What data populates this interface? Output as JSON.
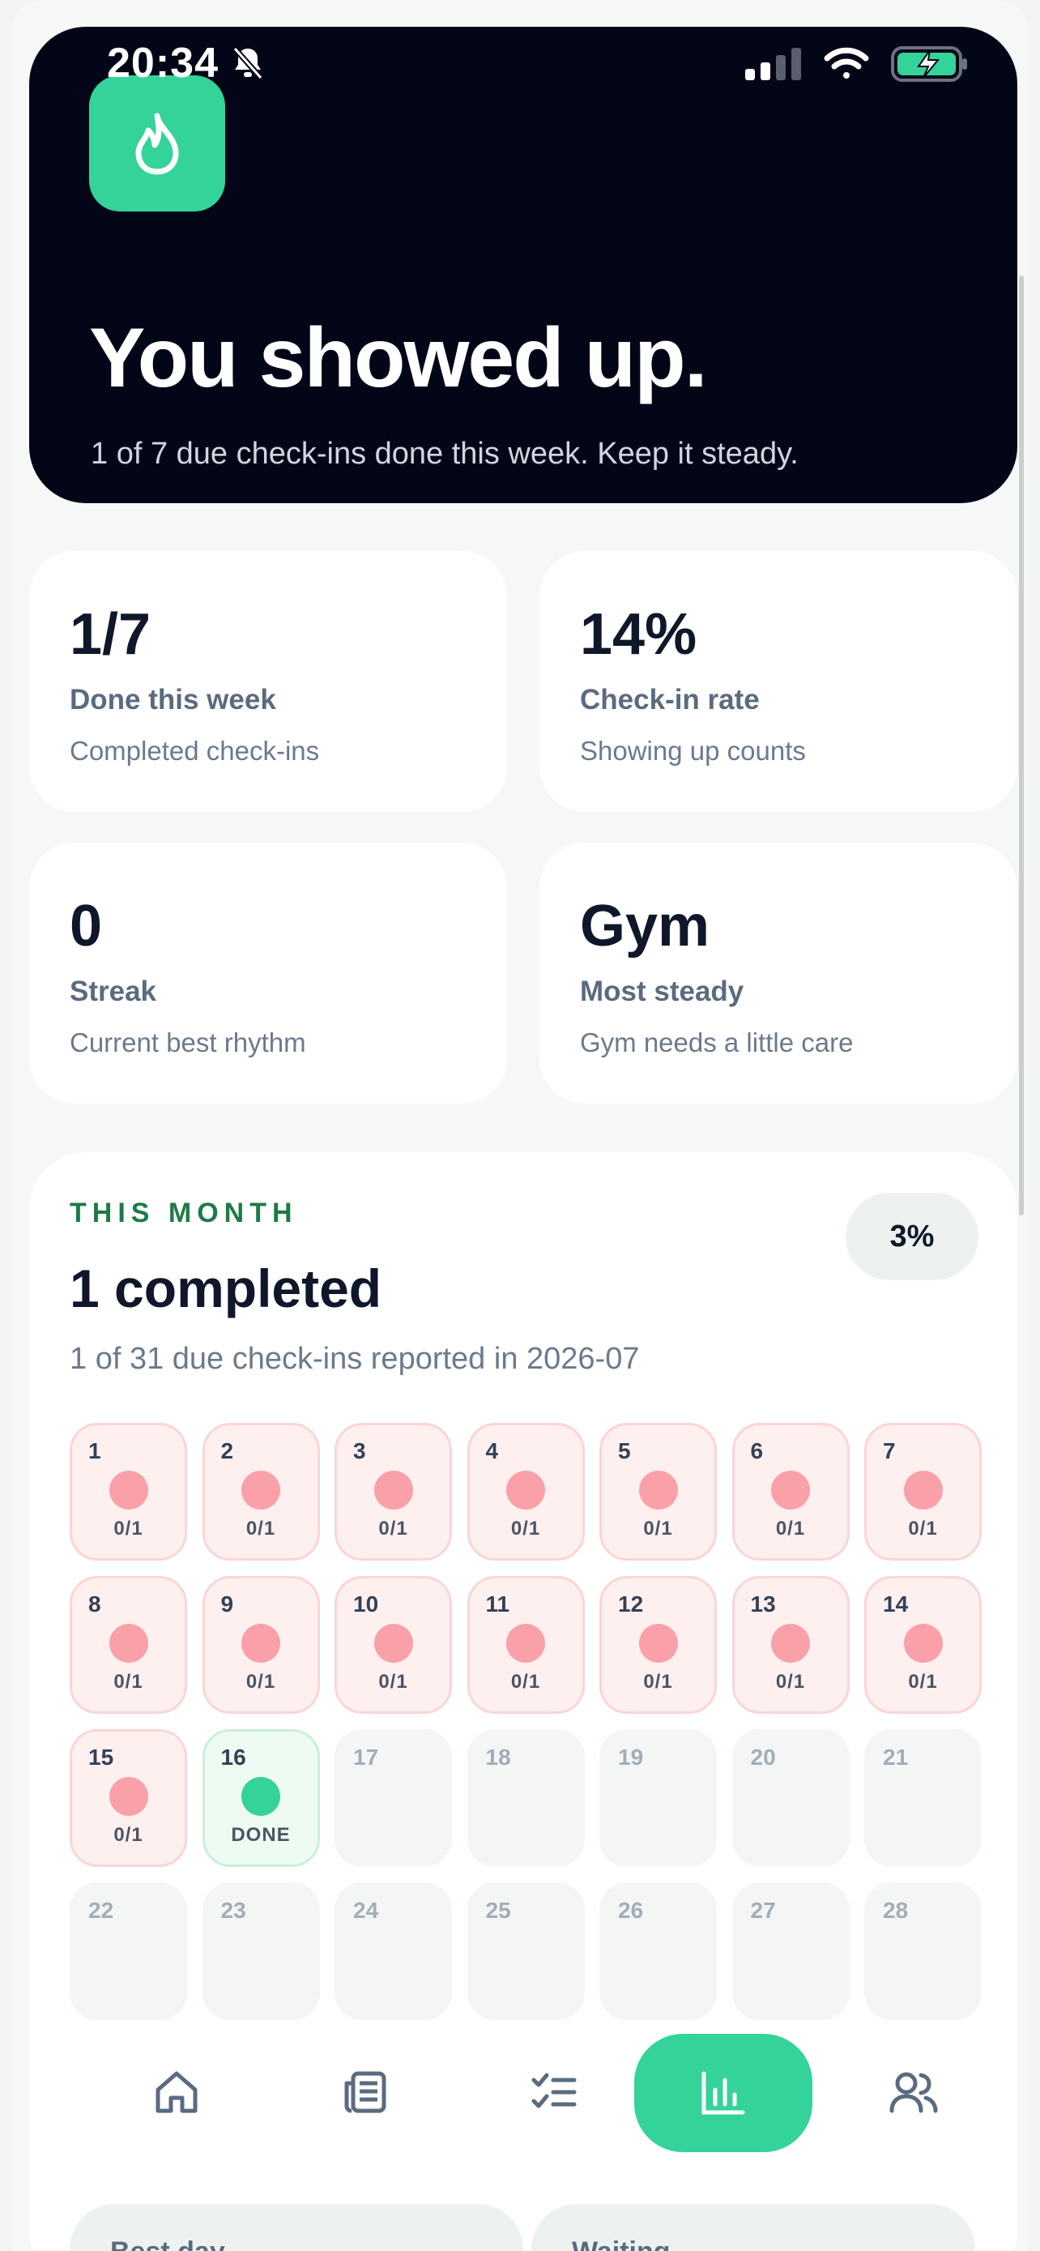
{
  "status": {
    "time": "20:34"
  },
  "hero": {
    "title": "You showed up.",
    "subtitle": "1 of 7 due check-ins done this week. Keep it steady."
  },
  "stats": [
    {
      "value": "1/7",
      "label": "Done this week",
      "desc": "Completed check-ins"
    },
    {
      "value": "14%",
      "label": "Check-in rate",
      "desc": "Showing up counts"
    },
    {
      "value": "0",
      "label": "Streak",
      "desc": "Current best rhythm"
    },
    {
      "value": "Gym",
      "label": "Most steady",
      "desc": "Gym needs a little care"
    }
  ],
  "month": {
    "eyebrow": "THIS MONTH",
    "percent": "3%",
    "headline": "1 completed",
    "subtitle": "1 of 31 due check-ins reported in 2026-07",
    "days": [
      {
        "day": "1",
        "state": "missed",
        "tag": "0/1"
      },
      {
        "day": "2",
        "state": "missed",
        "tag": "0/1"
      },
      {
        "day": "3",
        "state": "missed",
        "tag": "0/1"
      },
      {
        "day": "4",
        "state": "missed",
        "tag": "0/1"
      },
      {
        "day": "5",
        "state": "missed",
        "tag": "0/1"
      },
      {
        "day": "6",
        "state": "missed",
        "tag": "0/1"
      },
      {
        "day": "7",
        "state": "missed",
        "tag": "0/1"
      },
      {
        "day": "8",
        "state": "missed",
        "tag": "0/1"
      },
      {
        "day": "9",
        "state": "missed",
        "tag": "0/1"
      },
      {
        "day": "10",
        "state": "missed",
        "tag": "0/1"
      },
      {
        "day": "11",
        "state": "missed",
        "tag": "0/1"
      },
      {
        "day": "12",
        "state": "missed",
        "tag": "0/1"
      },
      {
        "day": "13",
        "state": "missed",
        "tag": "0/1"
      },
      {
        "day": "14",
        "state": "missed",
        "tag": "0/1"
      },
      {
        "day": "15",
        "state": "missed",
        "tag": "0/1"
      },
      {
        "day": "16",
        "state": "done",
        "tag": "DONE"
      },
      {
        "day": "17",
        "state": "future",
        "tag": ""
      },
      {
        "day": "18",
        "state": "future",
        "tag": ""
      },
      {
        "day": "19",
        "state": "future",
        "tag": ""
      },
      {
        "day": "20",
        "state": "future",
        "tag": ""
      },
      {
        "day": "21",
        "state": "future",
        "tag": ""
      },
      {
        "day": "22",
        "state": "future",
        "tag": ""
      },
      {
        "day": "23",
        "state": "future",
        "tag": ""
      },
      {
        "day": "24",
        "state": "future",
        "tag": ""
      },
      {
        "day": "25",
        "state": "future",
        "tag": ""
      },
      {
        "day": "26",
        "state": "future",
        "tag": ""
      },
      {
        "day": "27",
        "state": "future",
        "tag": ""
      },
      {
        "day": "28",
        "state": "future",
        "tag": ""
      }
    ]
  },
  "nav": [
    {
      "icon": "home-icon",
      "active": false
    },
    {
      "icon": "journal-icon",
      "active": false
    },
    {
      "icon": "checklist-icon",
      "active": false
    },
    {
      "icon": "bar-chart-icon",
      "active": true
    },
    {
      "icon": "users-icon",
      "active": false
    }
  ],
  "peek": {
    "left": "Best day",
    "right": "Waiting"
  },
  "colors": {
    "accent": "#34d399",
    "hero_bg": "#030616",
    "missed_bg": "#fff0f0",
    "missed_dot": "#f9a0a8",
    "eyebrow": "#1f7a46"
  }
}
